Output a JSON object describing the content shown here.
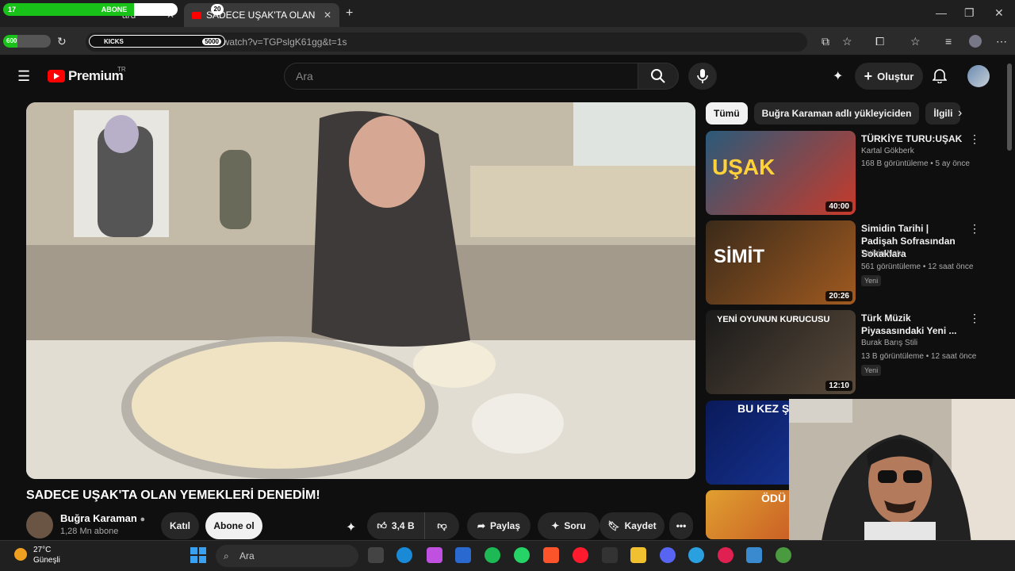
{
  "browser": {
    "tabs": [
      {
        "label": "ard"
      },
      {
        "label": "SADECE UŞAK'TA OLAN YEMEK"
      }
    ],
    "url": "https://www.youtube.com/watch?v=TGPslgK61gg&t=1s",
    "url_display": "https://www.youtube.com/watch?v=TGPslgK61gg&t=1s",
    "new_tab": "+",
    "close": "✕"
  },
  "overlays": {
    "abone_label": "ABONE",
    "abone_left": "17",
    "abone_count": "20",
    "left_count": "600",
    "kicks_label": "KICKS",
    "kicks_goal": "5000",
    "abone_progress": 0.75
  },
  "youtube": {
    "logo": "Premium",
    "region": "TR",
    "search_placeholder": "Ara",
    "create_label": "Oluştur"
  },
  "video": {
    "title": "SADECE UŞAK'TA OLAN YEMEKLERİ DENEDİM!",
    "channel": "Buğra Karaman",
    "subscribers": "1,28 Mn abone",
    "join": "Katıl",
    "subscribe": "Abone ol",
    "likes": "3,4 B",
    "share": "Paylaş",
    "ask": "Soru",
    "save": "Kaydet"
  },
  "chips": [
    "Tümü",
    "Buğra Karaman adlı yükleyiciden",
    "İlgili"
  ],
  "recommendations": [
    {
      "title": "TÜRKİYE TURU:UŞAK",
      "channel": "Kartal Gökberk",
      "meta": "168 B görüntüleme • 5 ay önce",
      "duration": "40:00",
      "new": "",
      "thumb_text": "UŞAK"
    },
    {
      "title": "Simidin Tarihi | Padişah Sofrasından Sokaklara",
      "channel": "Tarihin Notu",
      "meta": "561 görüntüleme • 12 saat önce",
      "duration": "20:26",
      "new": "Yeni",
      "thumb_text": "SİMİT"
    },
    {
      "title": "Türk Müzik Piyasasındaki Yeni ...",
      "channel": "Burak Barış Stili",
      "meta": "13 B görüntüleme • 12 saat önce",
      "duration": "12:10",
      "new": "Yeni",
      "thumb_text": "YENİ OYUNUN KURUCUSU"
    },
    {
      "title": "",
      "channel": "",
      "meta": "",
      "duration": "",
      "new": "",
      "thumb_text": "BU KEZ ŞAN"
    },
    {
      "title": "",
      "channel": "",
      "meta": "",
      "duration": "",
      "new": "",
      "thumb_text": "ÖDÜ"
    }
  ],
  "taskbar": {
    "temperature": "27°C",
    "weather": "Güneşli",
    "search_placeholder": "Ara"
  }
}
